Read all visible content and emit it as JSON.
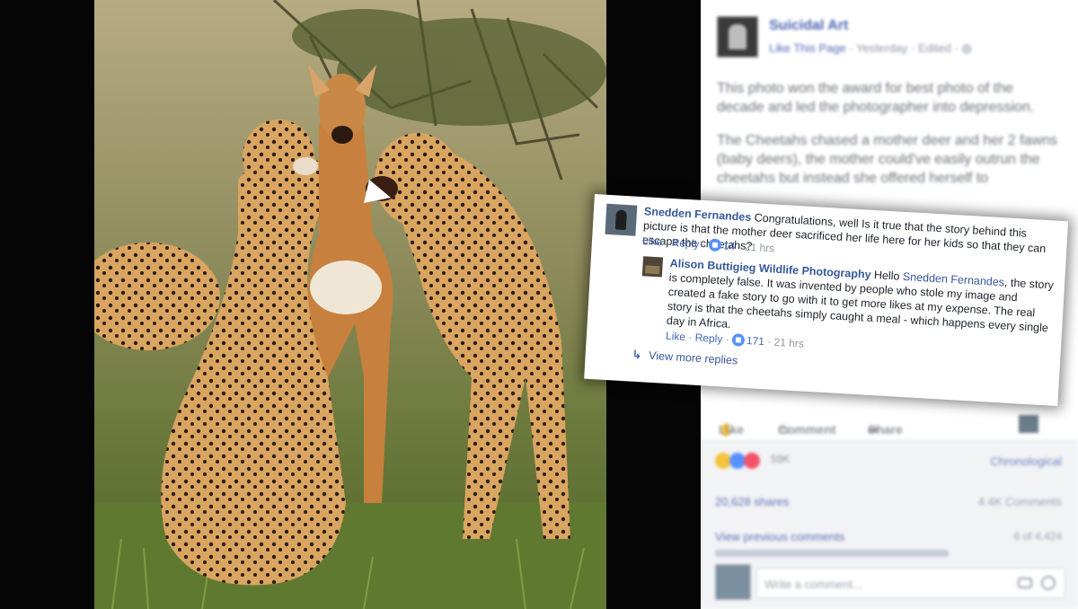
{
  "post": {
    "page_name": "Suicidal Art",
    "like_page": "Like This Page",
    "time": "Yesterday",
    "edited": "Edited",
    "paragraph1": "This photo won the award for best photo of the decade and led the photographer into depression.",
    "paragraph2": "The Cheetahs chased a mother deer and her 2 fawns (baby deers), the mother could've easily outrun the cheetahs but instead she offered herself to"
  },
  "actions": {
    "like": "Like",
    "comment": "Comment",
    "share": "Share"
  },
  "stats": {
    "reaction_count": "59K",
    "sort": "Chronological",
    "shares": "20,628 shares",
    "comments": "4.4K Comments",
    "view_previous": "View previous comments",
    "page_of": "6 of 4,424"
  },
  "composer": {
    "placeholder": "Write a comment..."
  },
  "comment1": {
    "author": "Snedden Fernandes",
    "text": "Congratulations, well Is it true that the story behind this picture is that the mother deer sacrificed her life here for her kids so that they can escape the cheetahs?",
    "like": "Like",
    "reply": "Reply",
    "likes": "14",
    "time": "21 hrs"
  },
  "comment2": {
    "author": "Alison Buttigieg Wildlife Photography",
    "greeting": "Hello",
    "mention": "Snedden Fernandes",
    "text": ", the story is completely false. It was invented by people who stole my image and created a fake story to go with it to get more likes at my expense. The real story is that the cheetahs simply caught a meal - which happens every single day in Africa.",
    "like": "Like",
    "reply": "Reply",
    "likes": "171",
    "time": "21 hrs"
  },
  "view_more": "View more replies",
  "colors": {
    "fb_blue": "#365899",
    "like_blue": "#5890ff",
    "panel_gray": "#f2f3f5"
  },
  "icons": [
    "like-thumb-icon",
    "comment-icon",
    "share-icon",
    "camera-icon",
    "emoji-icon",
    "reply-arrow-icon"
  ]
}
